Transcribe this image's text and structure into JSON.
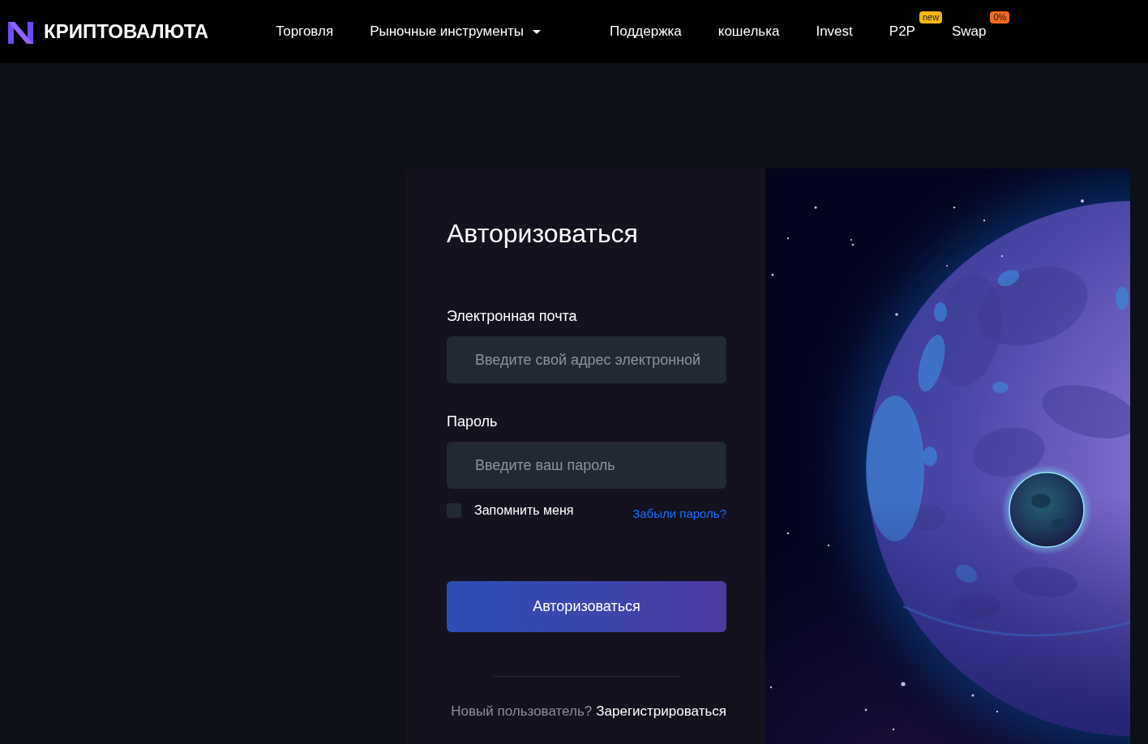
{
  "header": {
    "brand": "КРИПТОВАЛЮТА",
    "nav": [
      {
        "label": "Торговля",
        "kind": "link"
      },
      {
        "label": "Рыночные инструменты",
        "kind": "dropdown"
      },
      {
        "label": "Поддержка",
        "kind": "link"
      },
      {
        "label": "кошелька",
        "kind": "link"
      },
      {
        "label": "Invest",
        "kind": "link"
      },
      {
        "label": "P2P",
        "kind": "link",
        "badge": {
          "text": "new",
          "color": "#f0b90b"
        }
      },
      {
        "label": "Swap",
        "kind": "link",
        "badge": {
          "text": "0%",
          "color": "#f26b21"
        }
      }
    ]
  },
  "login": {
    "title": "Авторизоваться",
    "fields": [
      {
        "label": "Электронная почта",
        "placeholder": "Введите свой адрес электронной"
      },
      {
        "label": "Пароль",
        "placeholder": "Введите ваш пароль"
      }
    ],
    "remember": {
      "label": "Запомнить меня",
      "checked": false
    },
    "forgot_link": "Забыли пароль?",
    "submit": "Авторизоваться",
    "signup": {
      "prompt": "Новый пользователь?",
      "link": "Зарегистрироваться"
    }
  }
}
